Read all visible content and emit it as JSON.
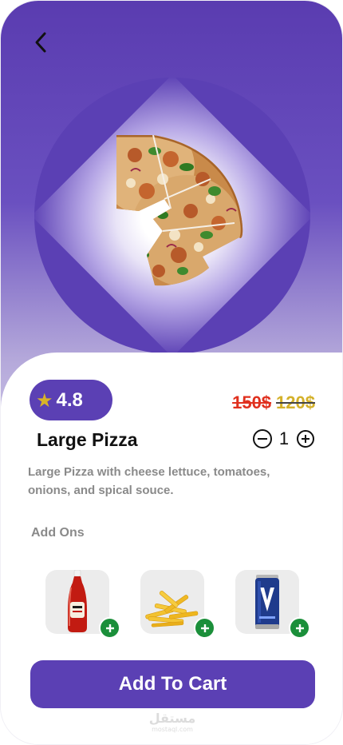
{
  "product": {
    "rating": "4.8",
    "old_price": "150$",
    "new_price": "120$",
    "title": "Large Pizza",
    "quantity": "1",
    "description": "Large Pizza with cheese lettuce, tomatoes, onions, and spical souce."
  },
  "addons": {
    "title": "Add Ons",
    "items": [
      {
        "icon": "ketchup-bottle"
      },
      {
        "icon": "french-fries"
      },
      {
        "icon": "soda-can"
      }
    ]
  },
  "cart": {
    "label": "Add To Cart"
  },
  "watermark": {
    "arabic": "مستقل",
    "latin": "mostaql.com"
  },
  "colors": {
    "primary": "#5b40b4",
    "star": "#d9b328",
    "old_price": "#e0301e",
    "new_price": "#d4b12a",
    "add_green": "#1b8f3a"
  }
}
